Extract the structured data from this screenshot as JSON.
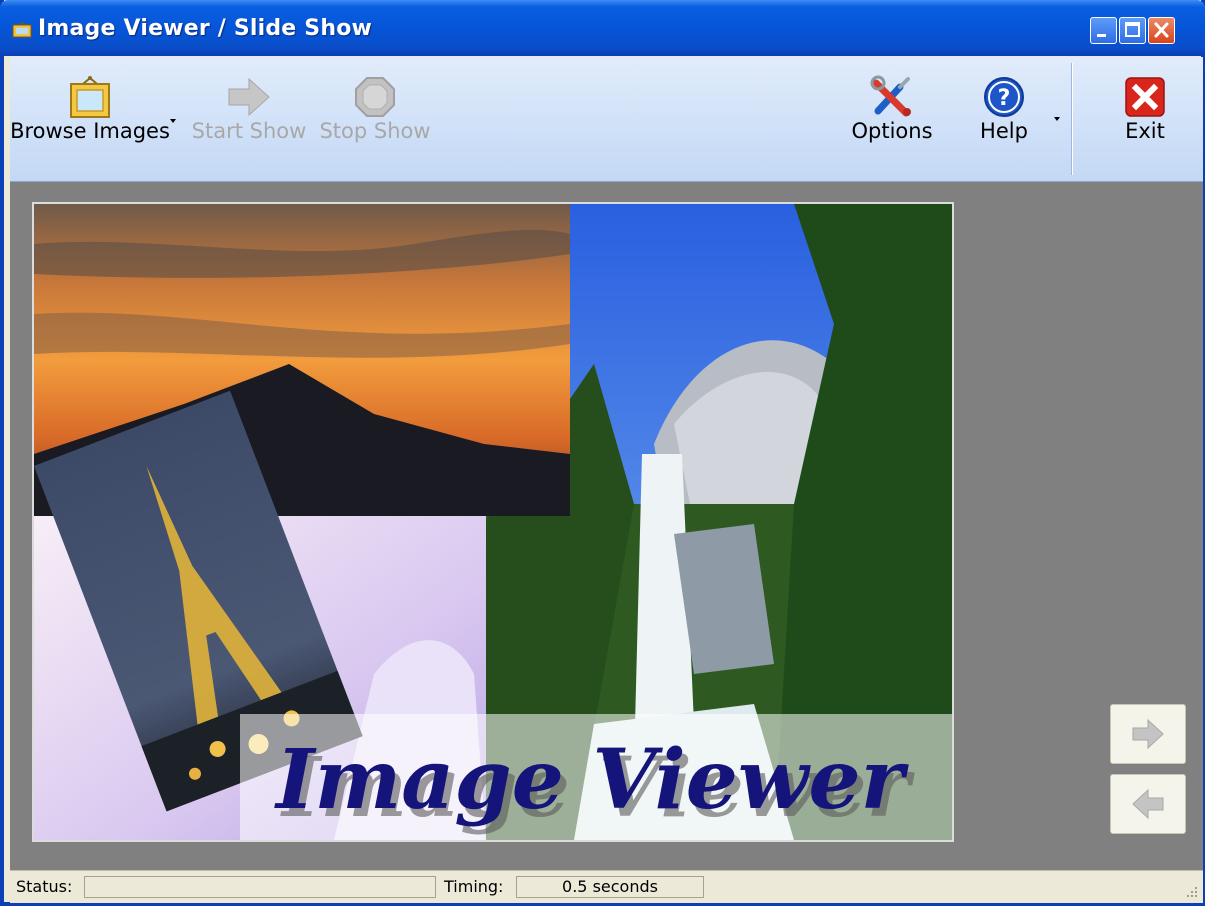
{
  "window": {
    "title": "Image Viewer / Slide Show"
  },
  "toolbar": {
    "browse_label": "Browse Images",
    "start_label": "Start Show",
    "stop_label": "Stop Show",
    "options_label": "Options",
    "help_label": "Help",
    "exit_label": "Exit"
  },
  "image": {
    "caption": "Image Viewer"
  },
  "status": {
    "status_label": "Status:",
    "status_value": "",
    "timing_label": "Timing:",
    "timing_value": "0.5 seconds"
  },
  "icons": {
    "app": "frame-icon",
    "browse": "picture-frame-icon",
    "start": "right-arrow-icon",
    "stop": "stop-octagon-icon",
    "options": "tools-icon",
    "help": "question-mark-icon",
    "exit": "x-icon",
    "next": "right-arrow-icon",
    "prev": "left-arrow-icon"
  },
  "colors": {
    "titlebar": "#0655d8",
    "toolbar": "#cfe0f8",
    "viewer_background": "#808080",
    "caption_text": "#14147a",
    "exit_red": "#d9261c",
    "help_blue": "#1e55c8"
  }
}
